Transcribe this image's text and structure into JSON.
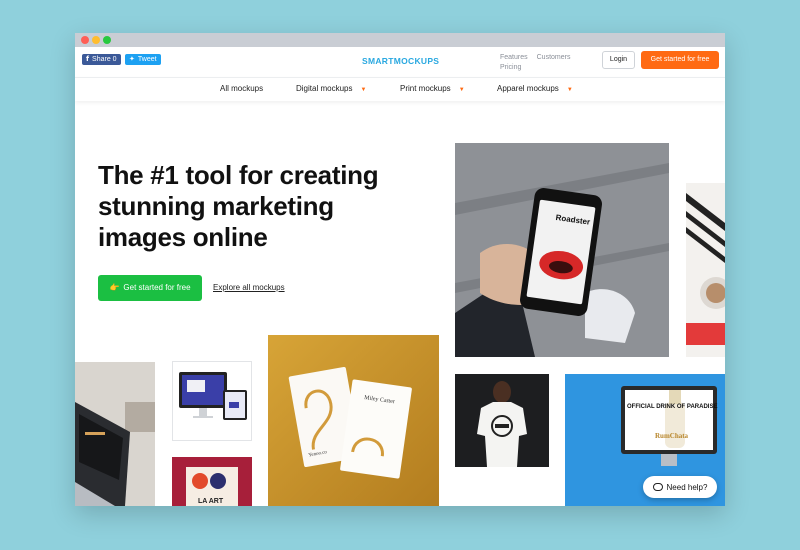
{
  "topbar": {
    "share_icon": "f",
    "share_label": "Share 0",
    "tweet_icon": "🐦",
    "tweet_label": "Tweet",
    "logo": "SMARTMOCKUPS",
    "link_features": "Features",
    "link_customers": "Customers",
    "link_pricing": "Pricing",
    "login": "Login",
    "cta": "Get started for free"
  },
  "nav": {
    "items": [
      {
        "label": "All mockups"
      },
      {
        "label": "Digital mockups",
        "caret": "▼"
      },
      {
        "label": "Print mockups",
        "caret": "▼"
      },
      {
        "label": "Apparel mockups",
        "caret": "▼"
      }
    ]
  },
  "hero": {
    "title": "The #1 tool for creating stunning marketing images online",
    "cta_icon": "👉",
    "cta_label": "Get started for free",
    "explore_label": "Explore all mockups"
  },
  "tiles": {
    "phone_screen_title": "Roadster",
    "card_name": "Miley Carter",
    "card_site": "Yenoo.co",
    "poster_text": "OFFICIAL DRINK OF PARADISE",
    "bottle_label": "RumChata",
    "art_text": "LA ART"
  },
  "chat": {
    "label": "Need help?"
  },
  "colors": {
    "accent_orange": "#ff6a13",
    "accent_green": "#1bbf42",
    "logo_blue": "#29a8e0"
  }
}
